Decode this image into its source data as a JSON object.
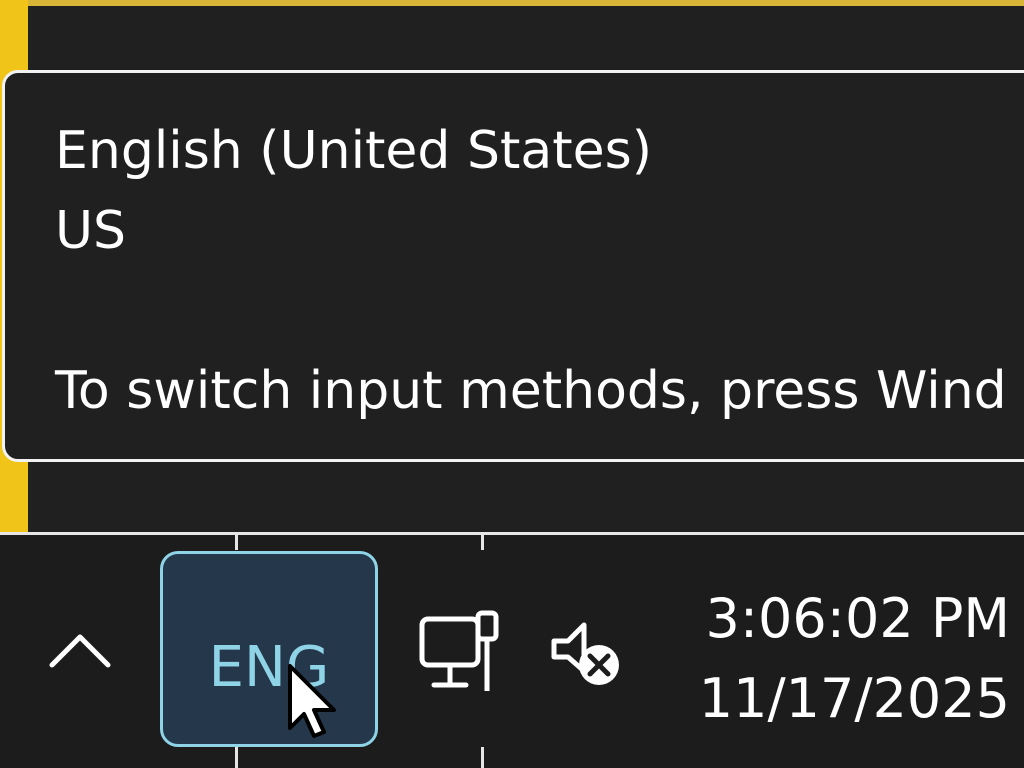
{
  "tooltip": {
    "language_name": "English (United States)",
    "layout": "US",
    "switch_hint": "To switch input methods, press Wind"
  },
  "taskbar": {
    "language_indicator": "ENG",
    "time": "3:06:02 PM",
    "date": "11/17/2025"
  },
  "icons": {
    "overflow": "chevron-up-icon",
    "network": "wired-network-icon",
    "volume": "volume-muted-icon",
    "pointer": "mouse-cursor-icon"
  },
  "colors": {
    "accent": "#8fd3e6",
    "lang_button_bg": "#25374a",
    "window_edge": "#f0c419",
    "taskbar_bg": "#1c1c1c",
    "text": "#ffffff"
  }
}
